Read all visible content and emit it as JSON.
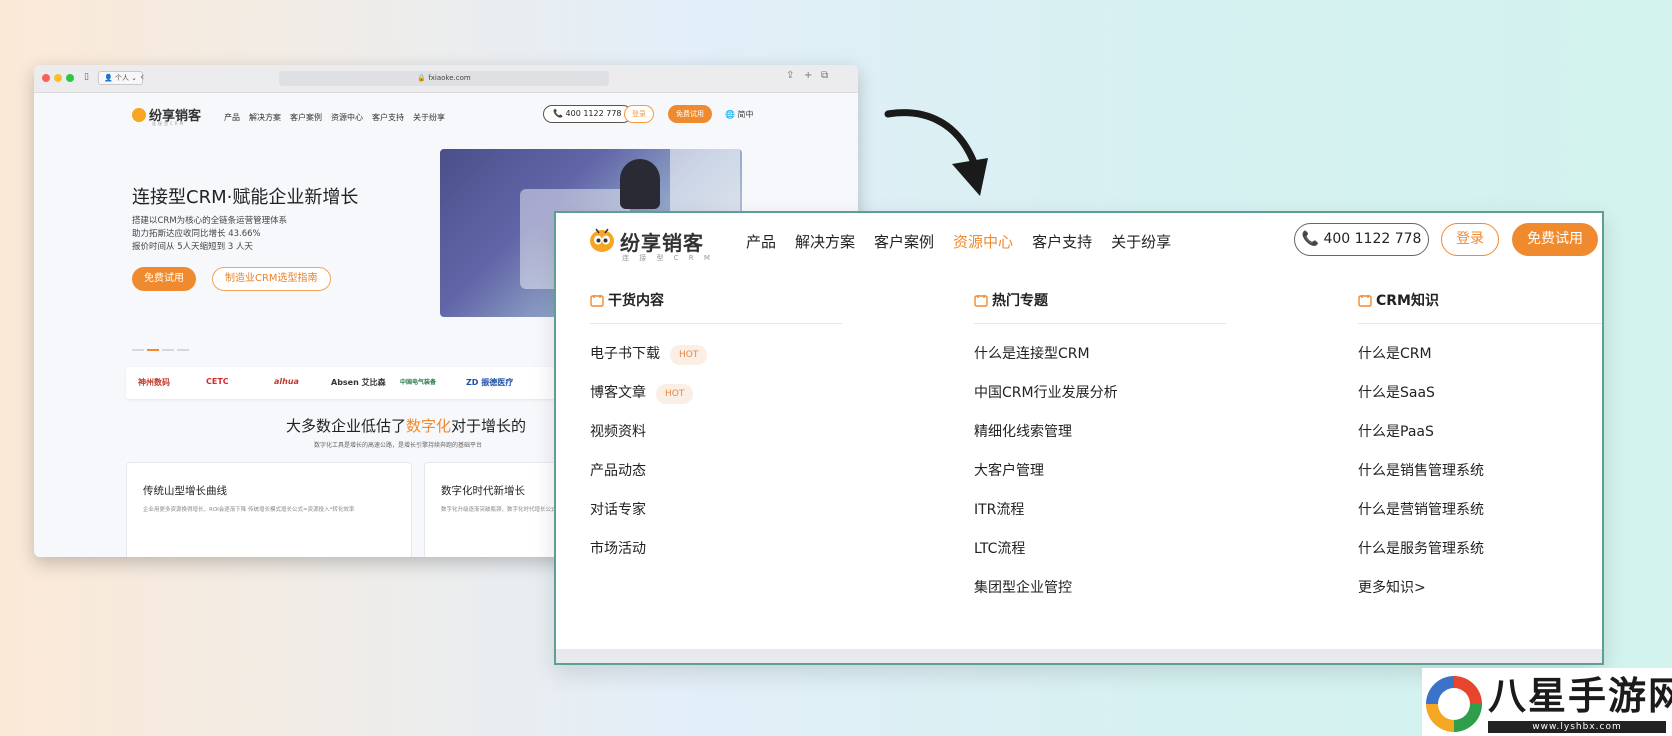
{
  "browser": {
    "profile": "个人",
    "url": "fxiaoke.com",
    "brand": "纷享销客",
    "brand_sub": "连接型CRM",
    "nav": [
      "产品",
      "解决方案",
      "客户案例",
      "资源中心",
      "客户支持",
      "关于纷享"
    ],
    "phone": "400 1122 778",
    "login": "登录",
    "trial": "免费试用",
    "lang": "简中",
    "hero_title": "连接型CRM·赋能企业新增长",
    "hero_lines": [
      "搭建以CRM为核心的全链条运营管理体系",
      "助力拓斯达应收同比增长 43.66%",
      "报价时间从 5人天缩短到 3 人天"
    ],
    "hero_btn_trial": "免费试用",
    "hero_btn_guide": "制造业CRM选型指南",
    "logos": [
      "神州数码",
      "CETC",
      "alhua",
      "Absen 艾比森",
      "中国电气装备",
      "ZD 振德医疗"
    ],
    "lower_title_pre": "大多数企业低估了",
    "lower_title_em": "数字化",
    "lower_title_post": "对于增长的",
    "lower_sub": "数字化工具是增长的高速公路，是增长引擎持续奔跑的基础平台",
    "card1_title": "传统山型增长曲线",
    "card1_text": "企业用更多资源换得增长，ROI会逐渐下降 传统增长模式增长公式=资源投入*转化效率",
    "card2_title": "数字化时代新增长",
    "card2_text": "数字化升级逐渐突破瓶颈，数字化时代增长公式=资源"
  },
  "panel": {
    "brand": "纷享销客",
    "brand_sub": "连 接 型 C R M",
    "nav": [
      "产品",
      "解决方案",
      "客户案例",
      "资源中心",
      "客户支持",
      "关于纷享"
    ],
    "active_nav_index": 3,
    "phone": "400 1122 778",
    "login": "登录",
    "trial": "免费试用",
    "columns": [
      {
        "title": "干货内容",
        "items": [
          {
            "label": "电子书下载",
            "badge": "HOT"
          },
          {
            "label": "博客文章",
            "badge": "HOT"
          },
          {
            "label": "视频资料"
          },
          {
            "label": "产品动态"
          },
          {
            "label": "对话专家"
          },
          {
            "label": "市场活动"
          }
        ]
      },
      {
        "title": "热门专题",
        "items": [
          {
            "label": "什么是连接型CRM"
          },
          {
            "label": "中国CRM行业发展分析"
          },
          {
            "label": "精细化线索管理"
          },
          {
            "label": "大客户管理"
          },
          {
            "label": "ITR流程"
          },
          {
            "label": "LTC流程"
          },
          {
            "label": "集团型企业管控"
          }
        ]
      },
      {
        "title": "CRM知识",
        "items": [
          {
            "label": "什么是CRM"
          },
          {
            "label": "什么是SaaS"
          },
          {
            "label": "什么是PaaS"
          },
          {
            "label": "什么是销售管理系统"
          },
          {
            "label": "什么是营销管理系统"
          },
          {
            "label": "什么是服务管理系统"
          },
          {
            "label": "更多知识>"
          }
        ]
      }
    ]
  },
  "watermark": {
    "title": "八星手游网",
    "url": "www.lyshbx.com"
  },
  "colors": {
    "accent": "#f08a2e",
    "frame": "#5f9e94"
  }
}
